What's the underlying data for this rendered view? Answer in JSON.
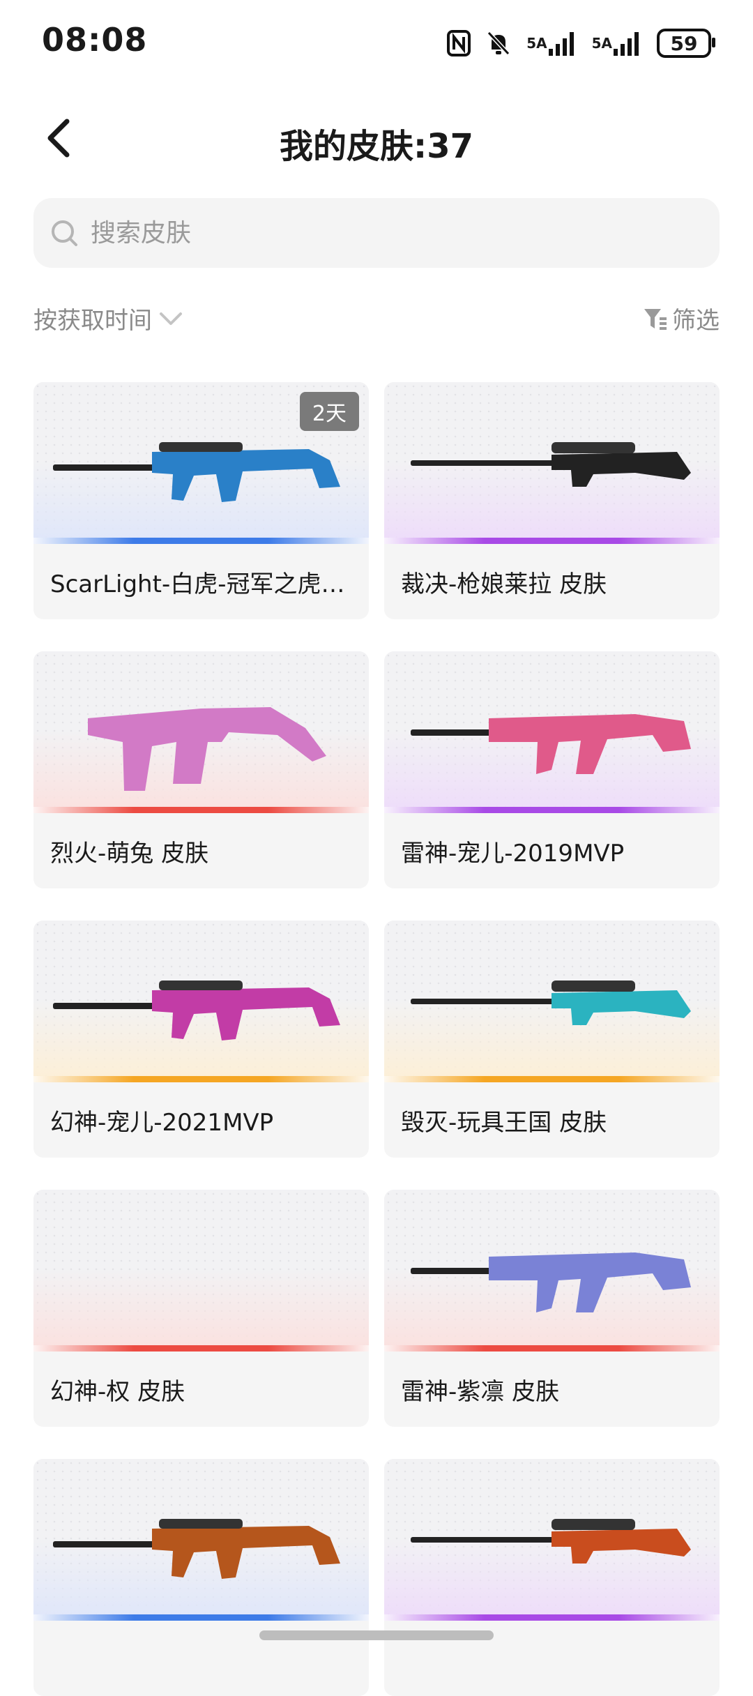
{
  "status_bar": {
    "time": "08:08",
    "signal1_label": "5A",
    "signal2_label": "5A",
    "battery": "59"
  },
  "header": {
    "title": "我的皮肤:37"
  },
  "search": {
    "placeholder": "搜索皮肤"
  },
  "toolbar": {
    "sort_label": "按获取时间",
    "filter_label": "筛选"
  },
  "items": [
    {
      "name": "ScarLight-白虎-冠军之虎…",
      "badge": "2天",
      "accent": "#3d7be8",
      "glow": "#dfe6fa",
      "gun": "#2a80c8"
    },
    {
      "name": "裁决-枪娘莱拉 皮肤",
      "badge": "",
      "accent": "#a84ae6",
      "glow": "#eedcfa",
      "gun": "#222222"
    },
    {
      "name": "烈火-萌兔 皮肤",
      "badge": "",
      "accent": "#ec4b42",
      "glow": "#fbe1df",
      "gun": "#d27ac6"
    },
    {
      "name": "雷神-宠儿-2019MVP",
      "badge": "",
      "accent": "#a84ae6",
      "glow": "#eedcfa",
      "gun": "#e05a8a"
    },
    {
      "name": "幻神-宠儿-2021MVP",
      "badge": "",
      "accent": "#f5a623",
      "glow": "#fdefd6",
      "gun": "#c23ca6"
    },
    {
      "name": "毁灭-玩具王国 皮肤",
      "badge": "",
      "accent": "#f5a623",
      "glow": "#fdefd6",
      "gun": "#2bb3c0"
    },
    {
      "name": "幻神-权 皮肤",
      "badge": "",
      "accent": "#ec4b42",
      "glow": "#fbe1df",
      "gun": ""
    },
    {
      "name": "雷神-紫凛 皮肤",
      "badge": "",
      "accent": "#ec4b42",
      "glow": "#fbe1df",
      "gun": "#7a82d6"
    },
    {
      "name": "",
      "badge": "",
      "accent": "#3d7be8",
      "glow": "#dfe6fa",
      "gun": "#b5561c"
    },
    {
      "name": "",
      "badge": "",
      "accent": "#a84ae6",
      "glow": "#eedcfa",
      "gun": "#c94d1e"
    }
  ]
}
